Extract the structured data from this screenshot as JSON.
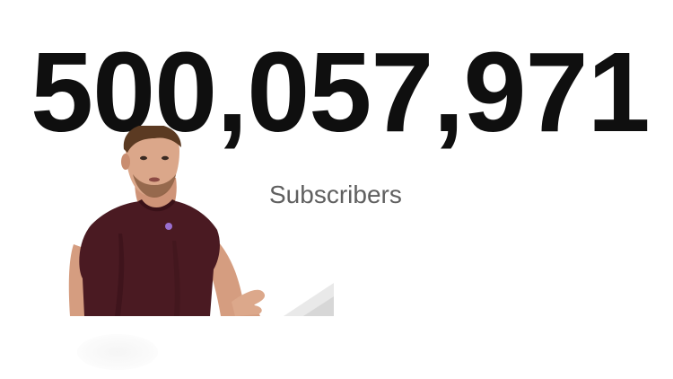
{
  "subscriber_count": "500,057,971",
  "subscriber_label": "Subscribers",
  "colors": {
    "background": "#ffffff",
    "count_text": "#0f0f0f",
    "label_text": "#606060",
    "shirt": "#4a1a22",
    "skin": "#d9a286"
  },
  "icons": {
    "presenter": "person-presenting"
  }
}
